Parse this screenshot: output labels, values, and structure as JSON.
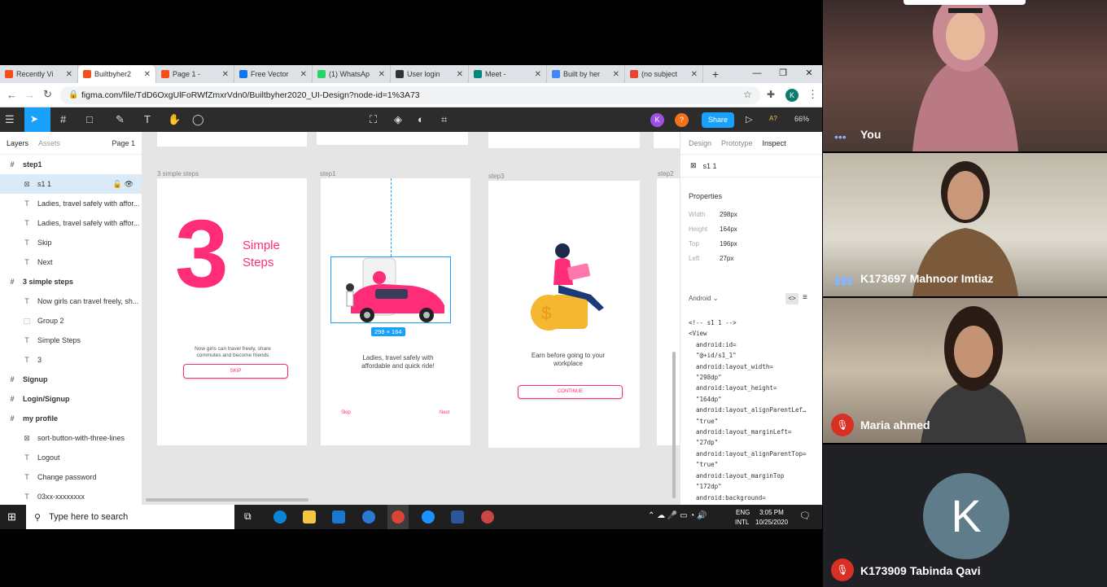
{
  "browser": {
    "tabs": [
      {
        "label": "Recently Vi",
        "color": "#f24e1e",
        "active": false
      },
      {
        "label": "Builtbyher2",
        "color": "#f24e1e",
        "active": true
      },
      {
        "label": "Page 1 -",
        "color": "#f24e1e",
        "active": false
      },
      {
        "label": "Free Vector",
        "color": "#1273eb",
        "active": false
      },
      {
        "label": "(1) WhatsAp",
        "color": "#25d366",
        "active": false
      },
      {
        "label": "User login",
        "color": "#333",
        "active": false
      },
      {
        "label": "Meet -",
        "color": "#00897b",
        "active": false
      },
      {
        "label": "Built by her",
        "color": "#4285f4",
        "active": false
      },
      {
        "label": "(no subject",
        "color": "#ea4335",
        "active": false
      }
    ],
    "new_tab": "+",
    "url": "figma.com/file/TdD6OxgUlFoRWfZmxrVdn0/Builtbyher2020_UI-Design?node-id=1%3A73",
    "profile_initial": "K"
  },
  "figma": {
    "zoom": "66%",
    "share_label": "Share",
    "avatar1": "K",
    "avatar2": "?",
    "left_tabs": {
      "layers": "Layers",
      "assets": "Assets",
      "page": "Page 1"
    },
    "layers": [
      {
        "type": "frame",
        "name": "step1"
      },
      {
        "type": "image",
        "name": "s1 1",
        "selected": true
      },
      {
        "type": "text",
        "name": "Ladies, travel safely with affor..."
      },
      {
        "type": "text",
        "name": "Ladies, travel safely with affor..."
      },
      {
        "type": "text",
        "name": "Skip"
      },
      {
        "type": "text",
        "name": "Next"
      },
      {
        "type": "frame",
        "name": "3 simple steps"
      },
      {
        "type": "text",
        "name": "Now girls can travel freely, sh..."
      },
      {
        "type": "group",
        "name": "Group 2"
      },
      {
        "type": "text",
        "name": "Simple Steps"
      },
      {
        "type": "text",
        "name": "3"
      },
      {
        "type": "frame",
        "name": "Signup"
      },
      {
        "type": "frame",
        "name": "Login/Signup"
      },
      {
        "type": "frame",
        "name": "my profile"
      },
      {
        "type": "image",
        "name": "sort-button-with-three-lines"
      },
      {
        "type": "text",
        "name": "Logout"
      },
      {
        "type": "text",
        "name": "Change password"
      },
      {
        "type": "text",
        "name": "03xx-xxxxxxxx"
      }
    ],
    "frames": {
      "f1": {
        "label": "3 simple steps",
        "big_number": "3",
        "title1": "Simple",
        "title2": "Steps",
        "body": "Now girls can travel freely, share commutes and become friends",
        "button": "SKIP"
      },
      "f2": {
        "label": "step1",
        "size_badge": "298 × 164",
        "body": "Ladies, travel safely with affordable and quick ride!",
        "skip": "Skip",
        "next": "Next"
      },
      "f3": {
        "label": "step3",
        "body": "Earn before going to your workplace",
        "button": "CONTINUE"
      },
      "f4": {
        "label": "step2"
      }
    },
    "right": {
      "tabs": {
        "design": "Design",
        "prototype": "Prototype",
        "inspect": "Inspect"
      },
      "selected": "s1 1",
      "properties_title": "Properties",
      "props": [
        {
          "k": "Width",
          "v": "298px"
        },
        {
          "k": "Height",
          "v": "164px"
        },
        {
          "k": "Top",
          "v": "196px"
        },
        {
          "k": "Left",
          "v": "27px"
        }
      ],
      "platform": "Android",
      "code": "<!-- s1 1 -->\n<View\n  android:id=\n  \"@+id/s1_1\"\n  android:layout_width=\n  \"298dp\"\n  android:layout_height=\n  \"164dp\"\n  android:layout_alignParentLef…\n  \"true\"\n  android:layout_marginLeft=\n  \"27dp\"\n  android:layout_alignParentTop=\n  \"true\"\n  android:layout_marginTop\n  \"172dp\"\n  android:background=",
      "help": "?"
    }
  },
  "taskbar": {
    "search_placeholder": "Type here to search",
    "lang1": "ENG",
    "lang2": "INTL",
    "time": "3:05 PM",
    "date": "10/25/2020",
    "notif": "1"
  },
  "meet": {
    "participants": [
      {
        "name": "You",
        "muted": false
      },
      {
        "name": "K173697 Mahnoor Imtiaz",
        "muted": false
      },
      {
        "name": "Maria ahmed",
        "muted": true
      },
      {
        "name": "K173909 Tabinda Qavi",
        "muted": true,
        "initial": "K"
      }
    ]
  },
  "colors": {
    "accent": "#ff2d78",
    "figma_blue": "#18a0fb",
    "meet_bg": "#202124"
  }
}
